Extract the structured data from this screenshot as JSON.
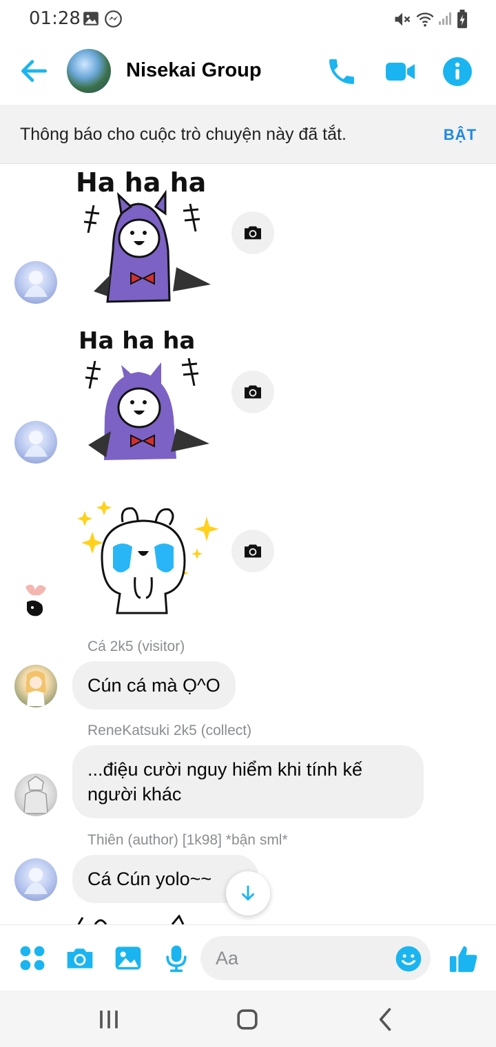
{
  "status_bar": {
    "time": "01:28",
    "icons": [
      "gallery-icon",
      "messenger-icon",
      "mute-icon",
      "wifi-icon",
      "signal-icon",
      "battery-icon"
    ]
  },
  "header": {
    "title": "Nisekai Group",
    "icons": [
      "back-arrow-icon",
      "phone-icon",
      "video-icon",
      "info-icon"
    ]
  },
  "notice": {
    "text": "Thông báo cho cuộc trò chuyện này đã tắt.",
    "action": "BẬT"
  },
  "stickers": [
    {
      "caption": "Ha ha ha"
    },
    {
      "caption": "Ha ha ha"
    },
    {
      "caption": ""
    }
  ],
  "messages": [
    {
      "sender": "Cá 2k5 (visitor)",
      "text": "Cún cá mà Ọ^O"
    },
    {
      "sender": "ReneKatsuki 2k5 (collect)",
      "lines": [
        "...điệu cười nguy hiểm khi tính kế",
        "người khác"
      ]
    },
    {
      "sender": "Thiên (author) [1k98] *bận sml*",
      "text": "Cá Cún yolo~~"
    }
  ],
  "composer": {
    "placeholder": "Aa",
    "icons": [
      "apps-icon",
      "camera-icon",
      "gallery-icon",
      "microphone-icon",
      "emoji-icon",
      "thumbs-up-icon"
    ]
  },
  "colors": {
    "accent": "#1ab5f0",
    "notice_action": "#1e88e5",
    "bubble": "#f0f0f0",
    "secondary_text": "#8a8d91"
  }
}
